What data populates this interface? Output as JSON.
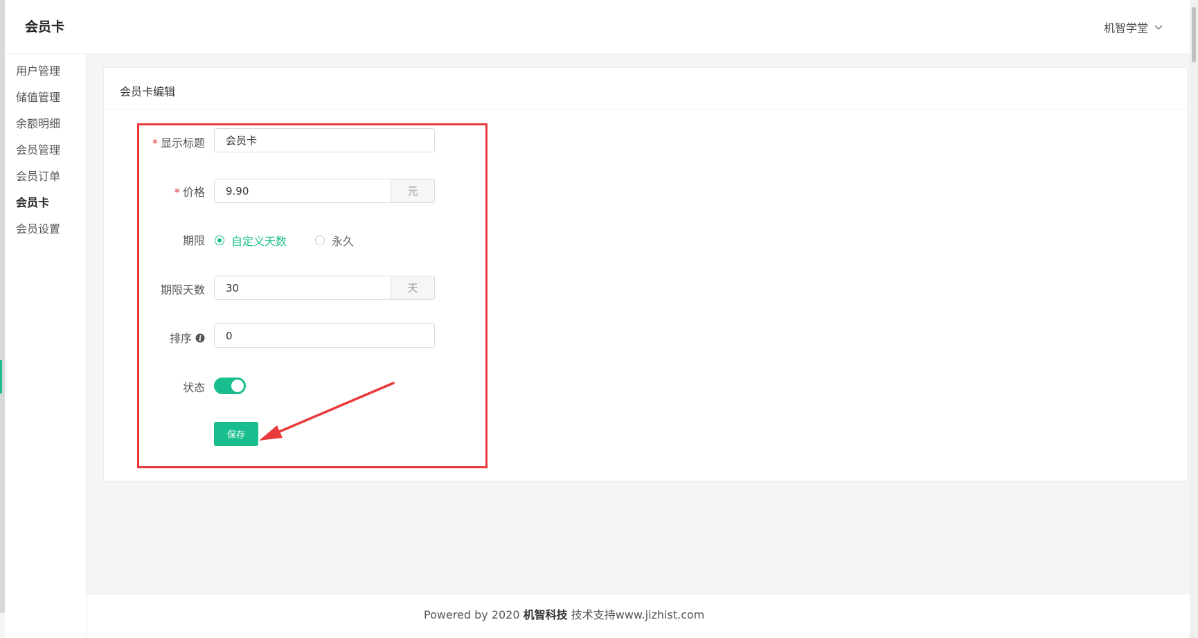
{
  "header": {
    "title": "会员卡",
    "user_name": "机智学堂"
  },
  "sidebar": {
    "items": [
      {
        "label": "用户管理"
      },
      {
        "label": "储值管理"
      },
      {
        "label": "余额明细"
      },
      {
        "label": "会员管理"
      },
      {
        "label": "会员订单"
      },
      {
        "label": "会员卡"
      },
      {
        "label": "会员设置"
      }
    ],
    "active": "会员卡"
  },
  "card": {
    "title": "会员卡编辑"
  },
  "form": {
    "display_title": {
      "label": "显示标题",
      "required": "*",
      "value": "会员卡"
    },
    "price": {
      "label": "价格",
      "required": "*",
      "value": "9.90",
      "suffix": "元"
    },
    "period": {
      "label": "期限",
      "options": [
        {
          "label": "自定义天数",
          "checked": true
        },
        {
          "label": "永久",
          "checked": false
        }
      ]
    },
    "period_days": {
      "label": "期限天数",
      "value": "30",
      "suffix": "天"
    },
    "sort": {
      "label": "排序",
      "value": "0"
    },
    "status": {
      "label": "状态",
      "on": true
    },
    "save_label": "保存"
  },
  "footer": {
    "prefix": "Powered by 2020",
    "company": "机智科技",
    "support": "技术支持www.jizhist.com"
  },
  "colors": {
    "accent": "#19be8e",
    "annotation_red": "#e83a3a"
  }
}
